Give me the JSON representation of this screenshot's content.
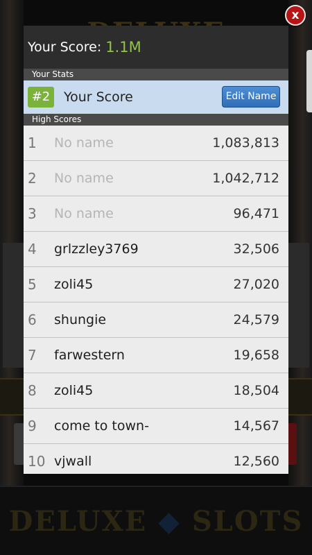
{
  "background": {
    "logo_top": "DELUXE SLOTS",
    "logo_bottom_left": "DELUXE",
    "logo_bottom_right": "SLOTS"
  },
  "close": {
    "label": "x"
  },
  "header": {
    "score_label": "Your Score:",
    "score_value": "1.1M"
  },
  "your_stats": {
    "section_label": "Your Stats",
    "rank": "#2",
    "name": "Your Score",
    "edit_label": "Edit Name"
  },
  "high_scores": {
    "section_label": "High Scores",
    "rows": [
      {
        "rank": "1",
        "name": "No name",
        "score": "1,083,813",
        "placeholder": true
      },
      {
        "rank": "2",
        "name": "No name",
        "score": "1,042,712",
        "placeholder": true
      },
      {
        "rank": "3",
        "name": "No name",
        "score": "96,471",
        "placeholder": true
      },
      {
        "rank": "4",
        "name": "grlzzley3769",
        "score": "32,506",
        "placeholder": false
      },
      {
        "rank": "5",
        "name": "zoli45",
        "score": "27,020",
        "placeholder": false
      },
      {
        "rank": "6",
        "name": "shungie",
        "score": "24,579",
        "placeholder": false
      },
      {
        "rank": "7",
        "name": "farwestern",
        "score": "19,658",
        "placeholder": false
      },
      {
        "rank": "8",
        "name": "zoli45",
        "score": "18,504",
        "placeholder": false
      },
      {
        "rank": "9",
        "name": "come to town-",
        "score": "14,567",
        "placeholder": false
      },
      {
        "rank": "10",
        "name": "vjwall",
        "score": "12,560",
        "placeholder": false
      }
    ]
  },
  "colors": {
    "accent_green": "#8fc44a",
    "badge_green": "#7ab23a",
    "button_blue": "#2f6fb8",
    "close_red": "#b71416"
  }
}
